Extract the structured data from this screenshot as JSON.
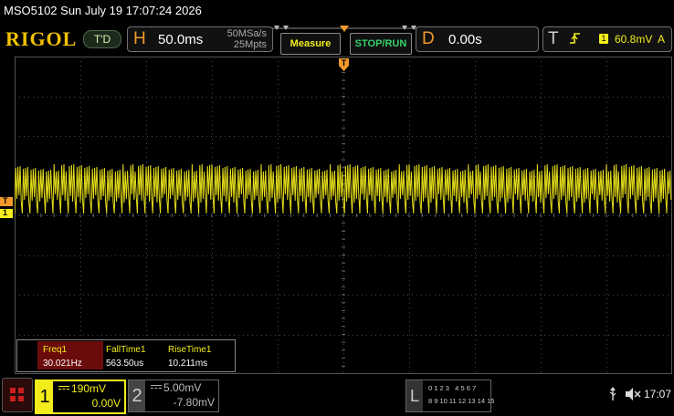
{
  "title_bar": {
    "text": "MSO5102  Sun July 19 17:07:24 2026"
  },
  "brand": {
    "logo": "RIGOL"
  },
  "status": {
    "trigger_state": "T'D"
  },
  "horizontal": {
    "letter": "H",
    "timebase": "50.0ms",
    "sample_rate": "50MSa/s",
    "memory_depth": "25Mpts"
  },
  "buttons": {
    "measure": "Measure",
    "stop_run": "STOP/RUN"
  },
  "delay": {
    "letter": "D",
    "value": "0.00s"
  },
  "trigger": {
    "letter": "T",
    "channel": "1",
    "level": "60.8mV",
    "mode": "A"
  },
  "markers": {
    "trigger_marker": "T",
    "trigger_level_marker": "T",
    "ch1_marker": "1"
  },
  "measurements": {
    "headers": [
      "Freq1",
      "FallTime1",
      "RiseTime1"
    ],
    "values": [
      "30.021Hz",
      "563.50us",
      "10.211ms"
    ]
  },
  "channels": {
    "ch1": {
      "number": "1",
      "scale": "190mV",
      "offset": "0.00V"
    },
    "ch2": {
      "number": "2",
      "scale": "5.00mV",
      "offset": "-7.80mV"
    }
  },
  "digital": {
    "letter": "L",
    "row1": "0 1 2 3   4 5 6 7",
    "row2": "8 9 10 11 12 13 14 15"
  },
  "system": {
    "time": "17:07"
  },
  "colors": {
    "ch1": "#f3ed1b",
    "accent": "#f39a2c",
    "trigger": "#f39a2c",
    "button_green": "#36d36a",
    "button_yellow": "#f3ed1b"
  },
  "icons": [
    "menu-icon",
    "usb-icon",
    "speaker-muted-icon",
    "trigger-edge-icon",
    "trigger-marker-icon"
  ]
}
